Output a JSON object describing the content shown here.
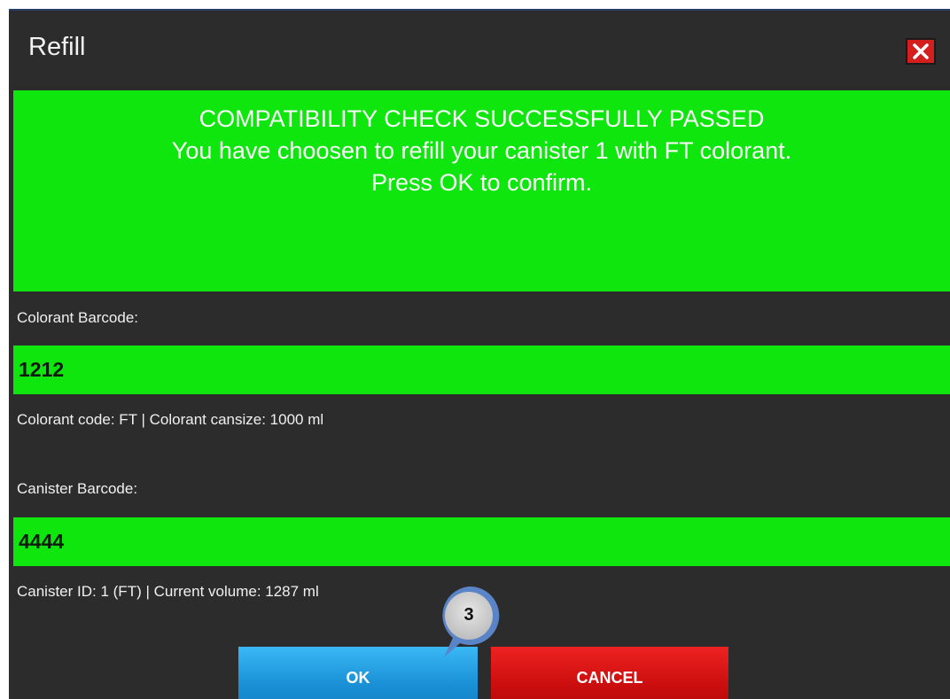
{
  "window": {
    "title": "Refill",
    "close_icon": "close-x-icon"
  },
  "banner": {
    "line1": "COMPATIBILITY CHECK SUCCESSFULLY PASSED",
    "line2": "You have choosen to refill your canister 1 with FT colorant.",
    "line3": "Press OK to confirm."
  },
  "colorant": {
    "label": "Colorant Barcode:",
    "value": "1212",
    "info": "Colorant code: FT  |  Colorant cansize: 1000 ml"
  },
  "canister": {
    "label": "Canister Barcode:",
    "value": "4444",
    "info": "Canister ID: 1 (FT) |  Current volume: 1287 ml"
  },
  "buttons": {
    "ok_label": "OK",
    "cancel_label": "CANCEL"
  },
  "callout": {
    "step": "3"
  },
  "colors": {
    "success_green": "#0ee60e",
    "dialog_bg": "#2c2c2c",
    "ok_blue": "#1a90d6",
    "cancel_red": "#cc0e0e",
    "close_red": "#d51f1f"
  }
}
